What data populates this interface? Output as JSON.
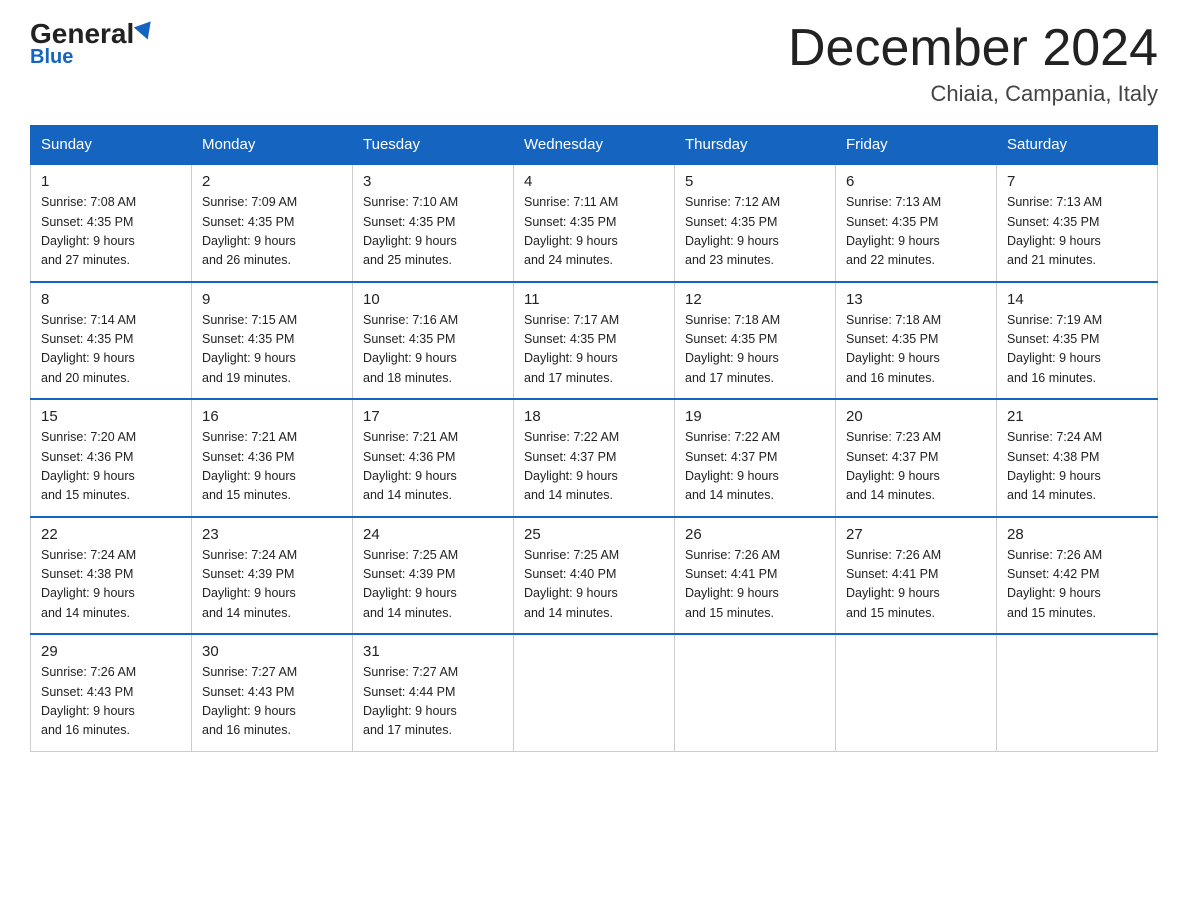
{
  "header": {
    "logo_general": "General",
    "logo_blue": "Blue",
    "month_title": "December 2024",
    "location": "Chiaia, Campania, Italy"
  },
  "weekdays": [
    "Sunday",
    "Monday",
    "Tuesday",
    "Wednesday",
    "Thursday",
    "Friday",
    "Saturday"
  ],
  "weeks": [
    [
      {
        "day": "1",
        "sunrise": "7:08 AM",
        "sunset": "4:35 PM",
        "daylight": "9 hours and 27 minutes."
      },
      {
        "day": "2",
        "sunrise": "7:09 AM",
        "sunset": "4:35 PM",
        "daylight": "9 hours and 26 minutes."
      },
      {
        "day": "3",
        "sunrise": "7:10 AM",
        "sunset": "4:35 PM",
        "daylight": "9 hours and 25 minutes."
      },
      {
        "day": "4",
        "sunrise": "7:11 AM",
        "sunset": "4:35 PM",
        "daylight": "9 hours and 24 minutes."
      },
      {
        "day": "5",
        "sunrise": "7:12 AM",
        "sunset": "4:35 PM",
        "daylight": "9 hours and 23 minutes."
      },
      {
        "day": "6",
        "sunrise": "7:13 AM",
        "sunset": "4:35 PM",
        "daylight": "9 hours and 22 minutes."
      },
      {
        "day": "7",
        "sunrise": "7:13 AM",
        "sunset": "4:35 PM",
        "daylight": "9 hours and 21 minutes."
      }
    ],
    [
      {
        "day": "8",
        "sunrise": "7:14 AM",
        "sunset": "4:35 PM",
        "daylight": "9 hours and 20 minutes."
      },
      {
        "day": "9",
        "sunrise": "7:15 AM",
        "sunset": "4:35 PM",
        "daylight": "9 hours and 19 minutes."
      },
      {
        "day": "10",
        "sunrise": "7:16 AM",
        "sunset": "4:35 PM",
        "daylight": "9 hours and 18 minutes."
      },
      {
        "day": "11",
        "sunrise": "7:17 AM",
        "sunset": "4:35 PM",
        "daylight": "9 hours and 17 minutes."
      },
      {
        "day": "12",
        "sunrise": "7:18 AM",
        "sunset": "4:35 PM",
        "daylight": "9 hours and 17 minutes."
      },
      {
        "day": "13",
        "sunrise": "7:18 AM",
        "sunset": "4:35 PM",
        "daylight": "9 hours and 16 minutes."
      },
      {
        "day": "14",
        "sunrise": "7:19 AM",
        "sunset": "4:35 PM",
        "daylight": "9 hours and 16 minutes."
      }
    ],
    [
      {
        "day": "15",
        "sunrise": "7:20 AM",
        "sunset": "4:36 PM",
        "daylight": "9 hours and 15 minutes."
      },
      {
        "day": "16",
        "sunrise": "7:21 AM",
        "sunset": "4:36 PM",
        "daylight": "9 hours and 15 minutes."
      },
      {
        "day": "17",
        "sunrise": "7:21 AM",
        "sunset": "4:36 PM",
        "daylight": "9 hours and 14 minutes."
      },
      {
        "day": "18",
        "sunrise": "7:22 AM",
        "sunset": "4:37 PM",
        "daylight": "9 hours and 14 minutes."
      },
      {
        "day": "19",
        "sunrise": "7:22 AM",
        "sunset": "4:37 PM",
        "daylight": "9 hours and 14 minutes."
      },
      {
        "day": "20",
        "sunrise": "7:23 AM",
        "sunset": "4:37 PM",
        "daylight": "9 hours and 14 minutes."
      },
      {
        "day": "21",
        "sunrise": "7:24 AM",
        "sunset": "4:38 PM",
        "daylight": "9 hours and 14 minutes."
      }
    ],
    [
      {
        "day": "22",
        "sunrise": "7:24 AM",
        "sunset": "4:38 PM",
        "daylight": "9 hours and 14 minutes."
      },
      {
        "day": "23",
        "sunrise": "7:24 AM",
        "sunset": "4:39 PM",
        "daylight": "9 hours and 14 minutes."
      },
      {
        "day": "24",
        "sunrise": "7:25 AM",
        "sunset": "4:39 PM",
        "daylight": "9 hours and 14 minutes."
      },
      {
        "day": "25",
        "sunrise": "7:25 AM",
        "sunset": "4:40 PM",
        "daylight": "9 hours and 14 minutes."
      },
      {
        "day": "26",
        "sunrise": "7:26 AM",
        "sunset": "4:41 PM",
        "daylight": "9 hours and 15 minutes."
      },
      {
        "day": "27",
        "sunrise": "7:26 AM",
        "sunset": "4:41 PM",
        "daylight": "9 hours and 15 minutes."
      },
      {
        "day": "28",
        "sunrise": "7:26 AM",
        "sunset": "4:42 PM",
        "daylight": "9 hours and 15 minutes."
      }
    ],
    [
      {
        "day": "29",
        "sunrise": "7:26 AM",
        "sunset": "4:43 PM",
        "daylight": "9 hours and 16 minutes."
      },
      {
        "day": "30",
        "sunrise": "7:27 AM",
        "sunset": "4:43 PM",
        "daylight": "9 hours and 16 minutes."
      },
      {
        "day": "31",
        "sunrise": "7:27 AM",
        "sunset": "4:44 PM",
        "daylight": "9 hours and 17 minutes."
      },
      null,
      null,
      null,
      null
    ]
  ],
  "labels": {
    "sunrise": "Sunrise:",
    "sunset": "Sunset:",
    "daylight": "Daylight:"
  }
}
